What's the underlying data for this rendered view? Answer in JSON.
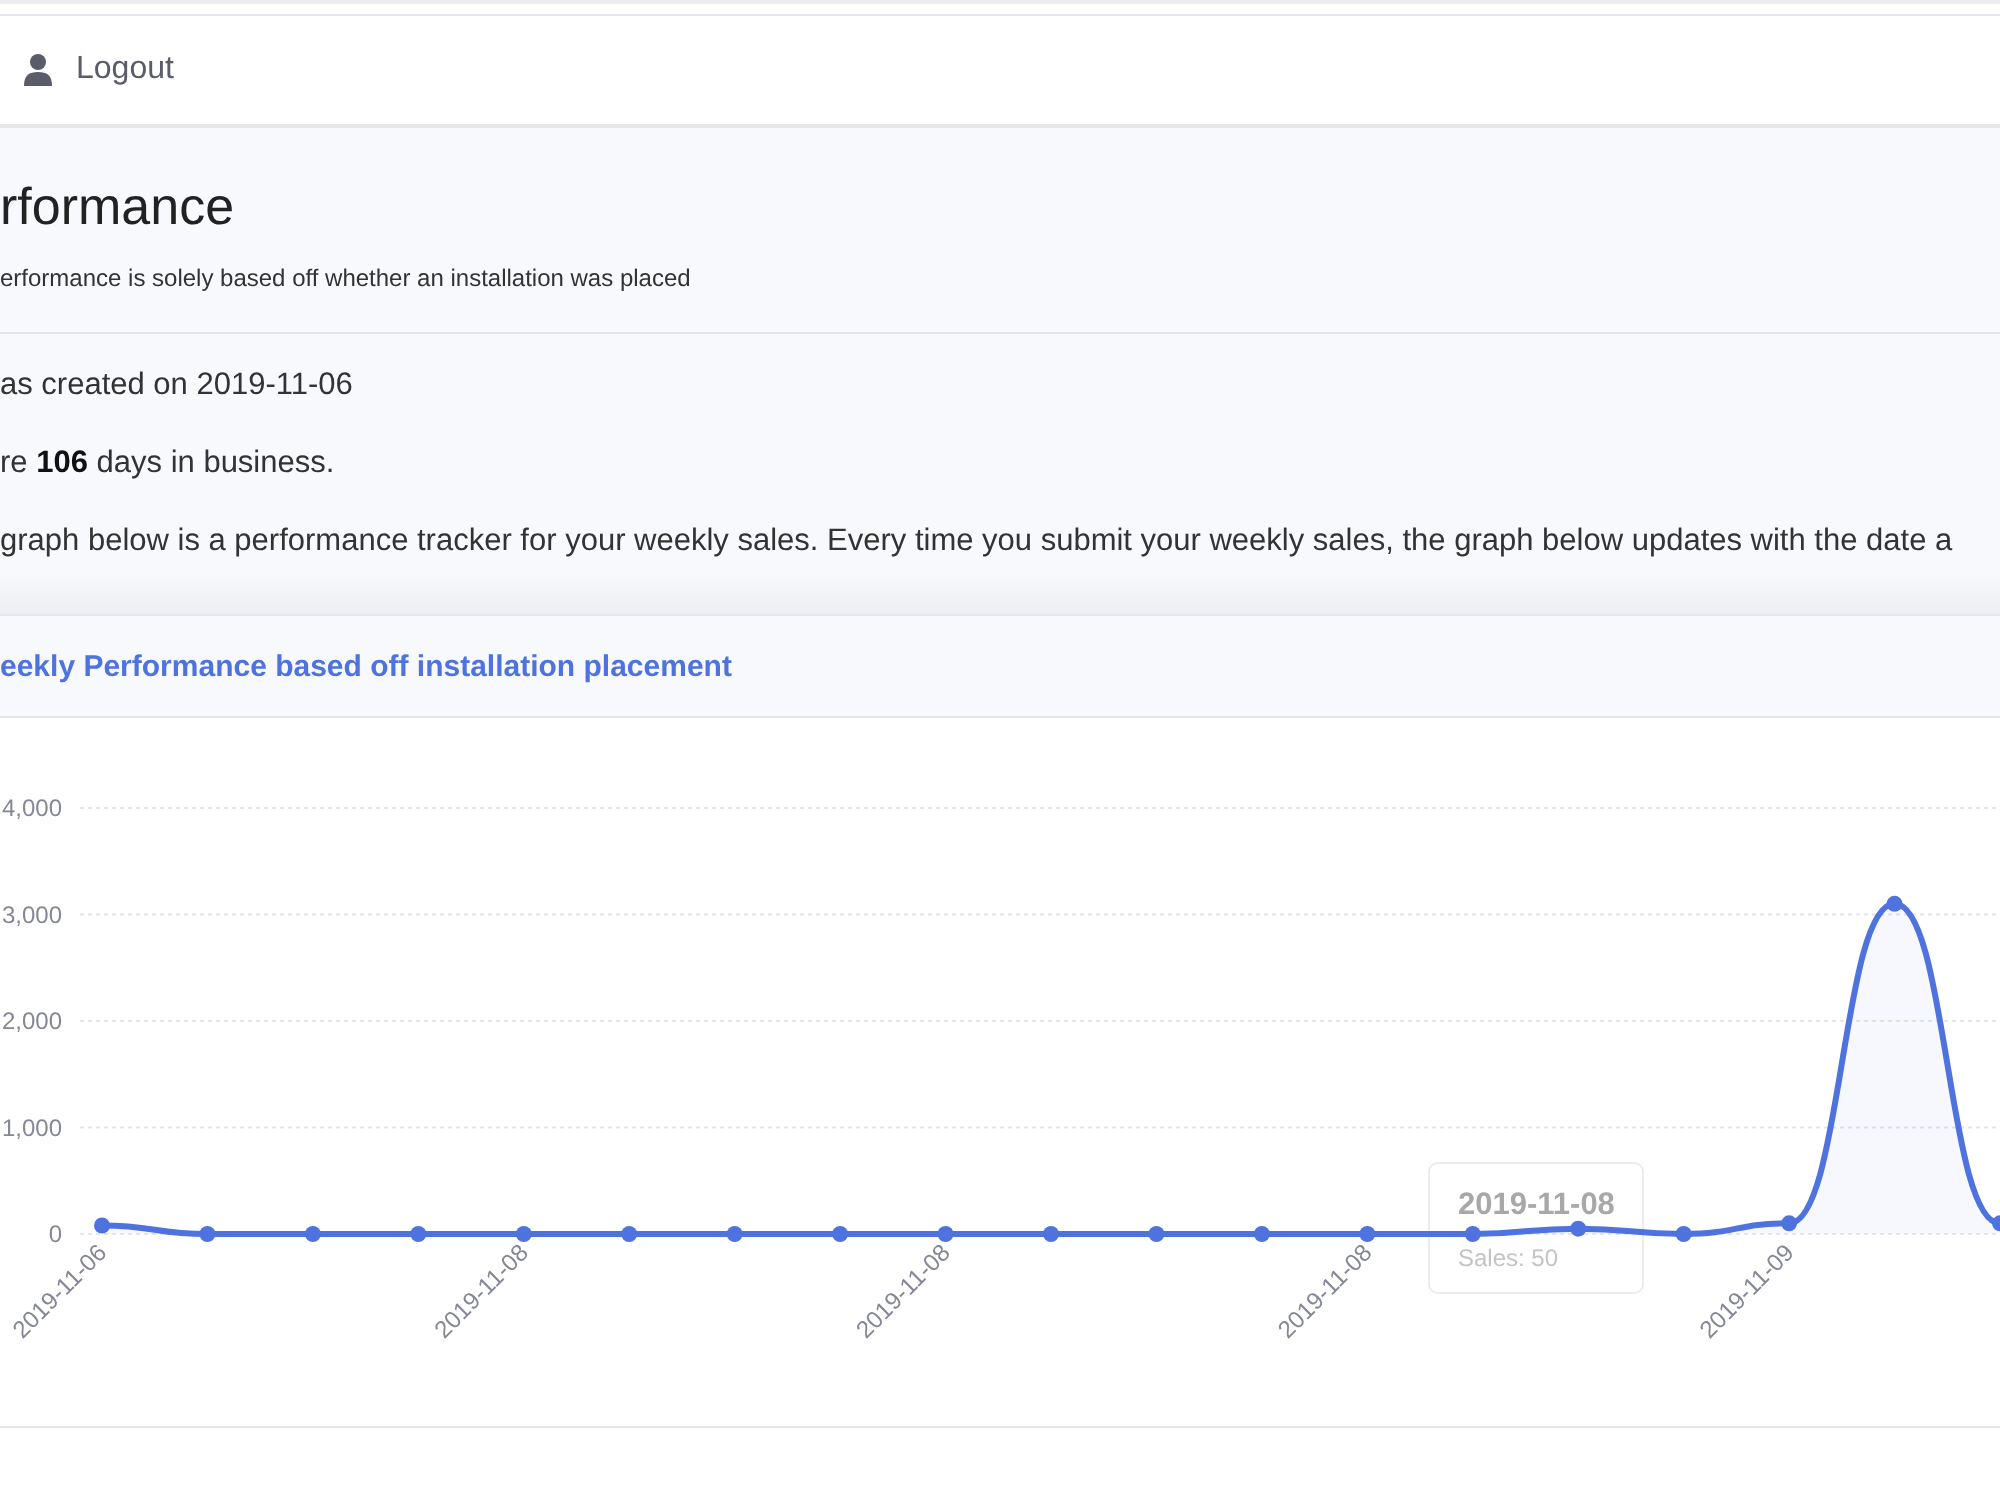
{
  "navbar": {
    "logout": "Logout"
  },
  "page_header": {
    "title": "rformance",
    "subtitle": "erformance is solely based off whether an installation was placed"
  },
  "info": [
    "as created on 2019-11-06",
    "re **106** days in business.",
    "graph below is a performance tracker for your weekly sales. Every time you submit your weekly sales, the graph below updates with the date a"
  ],
  "card": {
    "title": "eekly Performance based off installation placement",
    "chart_data": [
      {
        "type": "area",
        "categories": [
          "2019-11-06",
          null,
          null,
          null,
          "2019-11-08",
          null,
          null,
          null,
          "2019-11-08",
          null,
          null,
          null,
          "2019-11-08",
          null,
          null,
          null,
          "2019-11-09",
          null,
          null
        ],
        "values": [
          80,
          0,
          0,
          0,
          0,
          0,
          0,
          0,
          0,
          0,
          0,
          0,
          0,
          0,
          50,
          0,
          100,
          3100,
          100
        ],
        "color": "#4e73df",
        "ylim": [
          0,
          4000
        ],
        "yticks": [
          {
            "value": 0,
            "label": "0"
          },
          {
            "value": 1000,
            "label": "1,000"
          },
          {
            "value": 2000,
            "label": "2,000"
          },
          {
            "value": 3000,
            "label": "3,000"
          },
          {
            "value": 4000,
            "label": "4,000"
          }
        ],
        "marker": "circle",
        "grid": true
      }
    ],
    "tooltip": {
      "title": "2019-11-08",
      "text": "Sales: 50"
    }
  }
}
